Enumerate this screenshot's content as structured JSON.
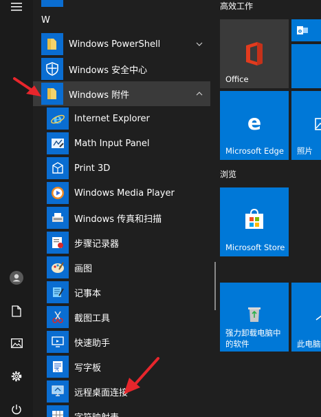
{
  "rail": {
    "items": [
      "menu",
      "user",
      "documents",
      "pictures",
      "settings",
      "power"
    ]
  },
  "app_list": {
    "section_letter": "W",
    "items": [
      {
        "label": "Windows PowerShell",
        "icon": "folder-icon",
        "has_chevron": true
      },
      {
        "label": "Windows 安全中心",
        "icon": "shield-icon"
      },
      {
        "label": "Windows 附件",
        "icon": "folder-icon",
        "has_chevron": true,
        "expanded": true
      },
      {
        "label": "Internet Explorer",
        "icon": "internet-explorer-icon"
      },
      {
        "label": "Math Input Panel",
        "icon": "math-input-icon"
      },
      {
        "label": "Print 3D",
        "icon": "print-3d-icon"
      },
      {
        "label": "Windows Media Player",
        "icon": "media-player-icon"
      },
      {
        "label": "Windows 传真和扫描",
        "icon": "fax-scan-icon"
      },
      {
        "label": "步骤记录器",
        "icon": "steps-recorder-icon"
      },
      {
        "label": "画图",
        "icon": "paint-icon"
      },
      {
        "label": "记事本",
        "icon": "notepad-icon"
      },
      {
        "label": "截图工具",
        "icon": "snipping-tool-icon"
      },
      {
        "label": "快速助手",
        "icon": "quick-assist-icon"
      },
      {
        "label": "写字板",
        "icon": "wordpad-icon"
      },
      {
        "label": "远程桌面连接",
        "icon": "remote-desktop-icon"
      },
      {
        "label": "字符映射表",
        "icon": "character-map-icon"
      }
    ]
  },
  "tiles": {
    "group_productivity": "高效工作",
    "group_browse": "浏览",
    "office": "Office",
    "edge": "Microsoft Edge",
    "photos": "照片",
    "store": "Microsoft Store",
    "uninstaller_line1": "强力卸载电脑中",
    "uninstaller_line2": "的软件",
    "this_pc": "此电脑"
  },
  "colors": {
    "tile_blue": "#0078d7",
    "office_tile": "#3a3a3a",
    "annotation_red": "#e8262c"
  }
}
